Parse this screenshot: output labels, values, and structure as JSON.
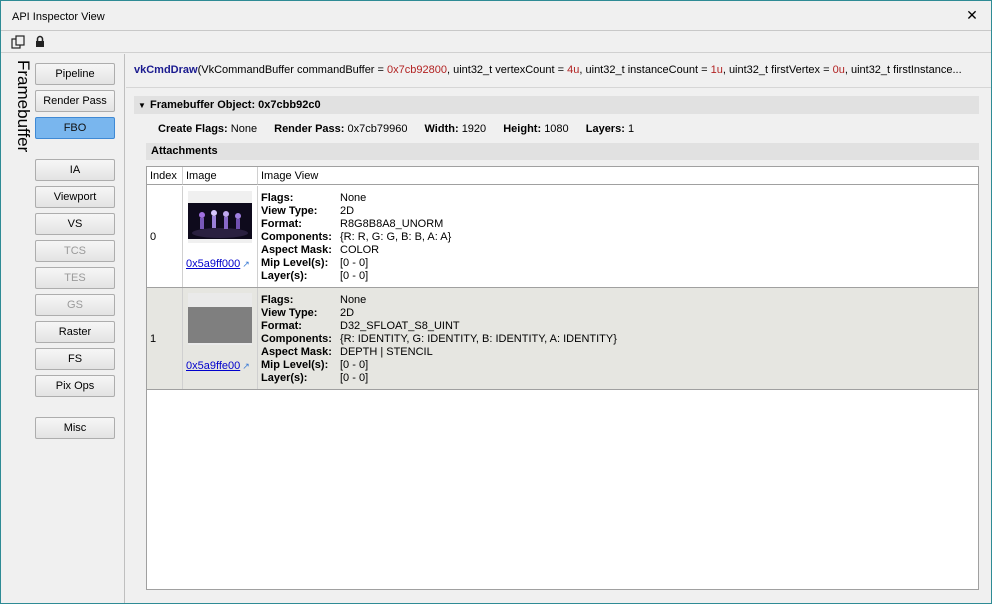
{
  "window": {
    "title": "API Inspector View"
  },
  "sidebar": {
    "label": "Framebuffer",
    "buttons": [
      {
        "label": "Pipeline",
        "state": "normal"
      },
      {
        "label": "Render Pass",
        "state": "normal"
      },
      {
        "label": "FBO",
        "state": "active"
      },
      {
        "label": "IA",
        "state": "normal"
      },
      {
        "label": "Viewport",
        "state": "normal"
      },
      {
        "label": "VS",
        "state": "normal"
      },
      {
        "label": "TCS",
        "state": "disabled"
      },
      {
        "label": "TES",
        "state": "disabled"
      },
      {
        "label": "GS",
        "state": "disabled"
      },
      {
        "label": "Raster",
        "state": "normal"
      },
      {
        "label": "FS",
        "state": "normal"
      },
      {
        "label": "Pix Ops",
        "state": "normal"
      },
      {
        "label": "Misc",
        "state": "normal"
      }
    ]
  },
  "call": {
    "name": "vkCmdDraw",
    "open": "(VkCommandBuffer commandBuffer = ",
    "cb_val": "0x7cb92800",
    "p2": ", uint32_t vertexCount = ",
    "vc_val": "4u",
    "p3": ", uint32_t instanceCount = ",
    "ic_val": "1u",
    "p4": ", uint32_t firstVertex = ",
    "fv_val": "0u",
    "p5": ", uint32_t firstInstance..."
  },
  "fbo": {
    "header": "Framebuffer Object: 0x7cbb92c0",
    "create_flags_label": "Create Flags:",
    "create_flags": "None",
    "render_pass_label": "Render Pass:",
    "render_pass": "0x7cb79960",
    "width_label": "Width:",
    "width": "1920",
    "height_label": "Height:",
    "height": "1080",
    "layers_label": "Layers:",
    "layers": "1"
  },
  "attachments": {
    "header": "Attachments",
    "columns": [
      "Index",
      "Image",
      "Image View"
    ],
    "rows": [
      {
        "index": "0",
        "image_link": "0x5a9ff000",
        "flags": "None",
        "view_type": "2D",
        "format": "R8G8B8A8_UNORM",
        "components": "{R: R, G: G, B: B, A: A}",
        "aspect_mask": "COLOR",
        "mip_levels": "[0 - 0]",
        "layers": "[0 - 0]"
      },
      {
        "index": "1",
        "image_link": "0x5a9ffe00",
        "flags": "None",
        "view_type": "2D",
        "format": "D32_SFLOAT_S8_UINT",
        "components": "{R: IDENTITY, G: IDENTITY, B: IDENTITY, A: IDENTITY}",
        "aspect_mask": "DEPTH | STENCIL",
        "mip_levels": "[0 - 0]",
        "layers": "[0 - 0]"
      }
    ],
    "labels": {
      "flags": "Flags:",
      "view_type": "View Type:",
      "format": "Format:",
      "components": "Components:",
      "aspect_mask": "Aspect Mask:",
      "mip_levels": "Mip Level(s):",
      "layers": "Layer(s):"
    }
  },
  "colors": {
    "accent": "#79b6ee",
    "link": "#0000cc",
    "call_name": "#1a1a8f",
    "call_value": "#b22222"
  },
  "icons": [
    "copy-icon",
    "lock-icon",
    "close-icon",
    "link-icon"
  ]
}
